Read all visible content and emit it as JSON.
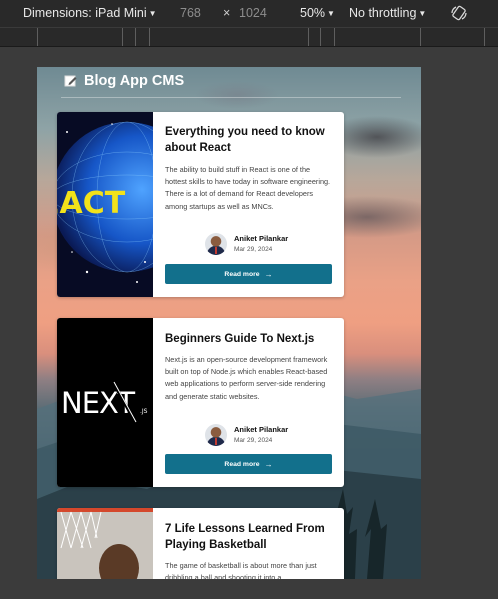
{
  "devtools": {
    "dimensions_label": "Dimensions: iPad Mini",
    "width": "768",
    "times": "×",
    "height": "1024",
    "zoom": "50%",
    "throttling": "No throttling",
    "icons": [
      "chevron-down-icon",
      "rotate-icon"
    ]
  },
  "app": {
    "title": "Blog App CMS",
    "icon": "pen-icon"
  },
  "posts": [
    {
      "title": "Everything you need to know about React",
      "excerpt": "The ability to build stuff in React is one of the hottest skills to have today in software engineering. There is a lot of demand for React developers among startups as well as MNCs.",
      "author": "Aniket Pilankar",
      "date": "Mar 29, 2024",
      "button": "Read more",
      "image_text": "EACT"
    },
    {
      "title": "Beginners Guide To Next.js",
      "excerpt": "Next.js is an open-source development framework built on top of Node.js which enables React-based web applications to perform server-side rendering and generate static websites.",
      "author": "Aniket Pilankar",
      "date": "Mar 29, 2024",
      "button": "Read more",
      "image_text": "NEXT",
      "image_suffix": ".JS"
    },
    {
      "title": "7 Life Lessons Learned From Playing Basketball",
      "excerpt": "The game of basketball is about more than just dribbling a ball and shooting it into a"
    }
  ],
  "colors": {
    "button": "#12708c",
    "devtools_bg": "#292929",
    "react_text": "#f2e21a"
  }
}
